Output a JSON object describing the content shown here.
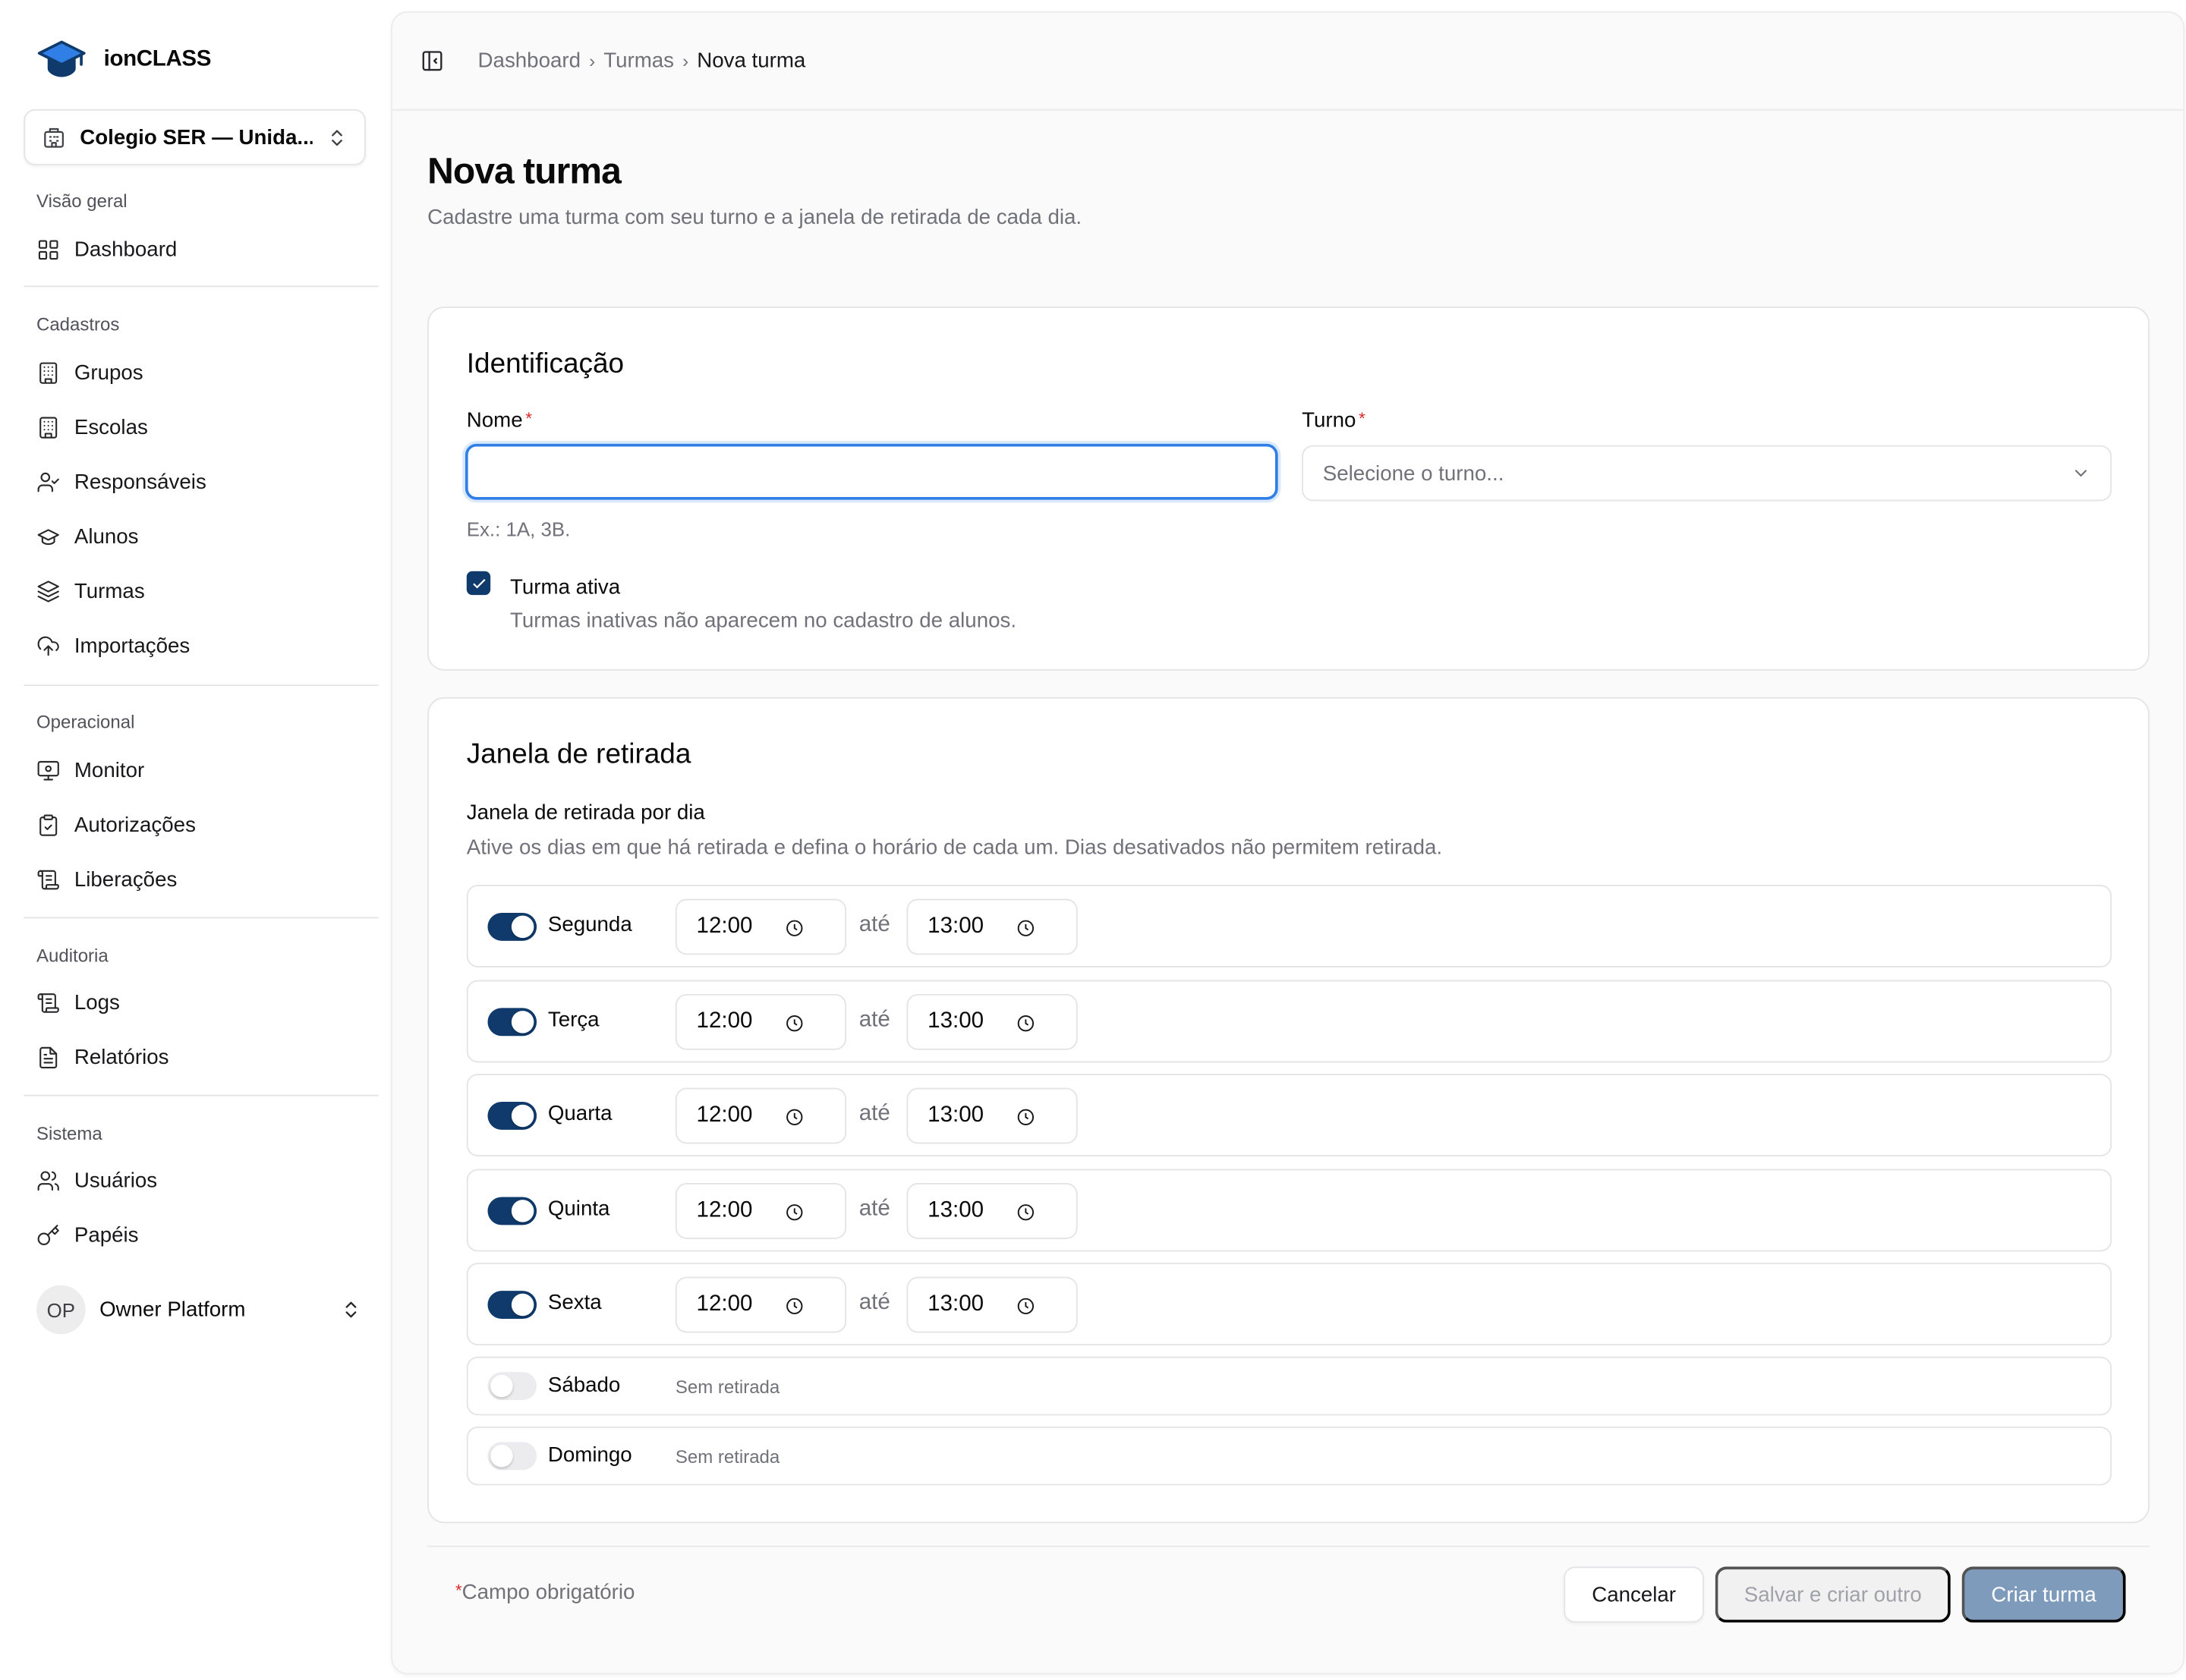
{
  "brand": {
    "name": "ionCLASS",
    "accent": "#0f3a6b",
    "logo_icon": "graduation-cap-icon"
  },
  "school_selector": {
    "label": "Colegio SER — Unida..."
  },
  "sidebar": {
    "groups": [
      {
        "title": "Visão geral",
        "items": [
          {
            "label": "Dashboard",
            "icon": "layout-grid-icon"
          }
        ]
      },
      {
        "title": "Cadastros",
        "items": [
          {
            "label": "Grupos",
            "icon": "building-icon"
          },
          {
            "label": "Escolas",
            "icon": "building-icon"
          },
          {
            "label": "Responsáveis",
            "icon": "user-check-icon"
          },
          {
            "label": "Alunos",
            "icon": "graduation-cap-icon"
          },
          {
            "label": "Turmas",
            "icon": "layers-icon"
          },
          {
            "label": "Importações",
            "icon": "cloud-upload-icon"
          }
        ]
      },
      {
        "title": "Operacional",
        "items": [
          {
            "label": "Monitor",
            "icon": "monitor-icon"
          },
          {
            "label": "Autorizações",
            "icon": "clipboard-check-icon"
          },
          {
            "label": "Liberações",
            "icon": "scroll-icon"
          }
        ]
      },
      {
        "title": "Auditoria",
        "items": [
          {
            "label": "Logs",
            "icon": "scroll-icon"
          },
          {
            "label": "Relatórios",
            "icon": "file-text-icon"
          }
        ]
      },
      {
        "title": "Sistema",
        "items": [
          {
            "label": "Usuários",
            "icon": "users-icon"
          },
          {
            "label": "Papéis",
            "icon": "key-icon"
          }
        ]
      }
    ]
  },
  "user": {
    "initials": "OP",
    "name": "Owner Platform"
  },
  "breadcrumb": [
    "Dashboard",
    "Turmas",
    "Nova turma"
  ],
  "page": {
    "title": "Nova turma",
    "subtitle": "Cadastre uma turma com seu turno e a janela de retirada de cada dia."
  },
  "identificacao": {
    "title": "Identificação",
    "nome_label": "Nome",
    "nome_value": "",
    "nome_hint": "Ex.: 1A, 3B.",
    "turno_label": "Turno",
    "turno_placeholder": "Selecione o turno...",
    "ativa_label": "Turma ativa",
    "ativa_checked": true,
    "ativa_hint": "Turmas inativas não aparecem no cadastro de alunos.",
    "required_mark": "*"
  },
  "janela": {
    "title": "Janela de retirada",
    "subtitle": "Janela de retirada por dia",
    "description": "Ative os dias em que há retirada e defina o horário de cada um. Dias desativados não permitem retirada.",
    "separator": "até",
    "days": [
      {
        "name": "Segunda",
        "enabled": true,
        "start": "12:00",
        "end": "13:00"
      },
      {
        "name": "Terça",
        "enabled": true,
        "start": "12:00",
        "end": "13:00"
      },
      {
        "name": "Quarta",
        "enabled": true,
        "start": "12:00",
        "end": "13:00"
      },
      {
        "name": "Quinta",
        "enabled": true,
        "start": "12:00",
        "end": "13:00"
      },
      {
        "name": "Sexta",
        "enabled": true,
        "start": "12:00",
        "end": "13:00"
      },
      {
        "name": "Sábado",
        "enabled": false,
        "empty_text": "Sem retirada"
      },
      {
        "name": "Domingo",
        "enabled": false,
        "empty_text": "Sem retirada"
      }
    ]
  },
  "footer": {
    "required_note": "Campo obrigatório",
    "cancel": "Cancelar",
    "save_and_new": "Salvar e criar outro",
    "create": "Criar turma"
  }
}
